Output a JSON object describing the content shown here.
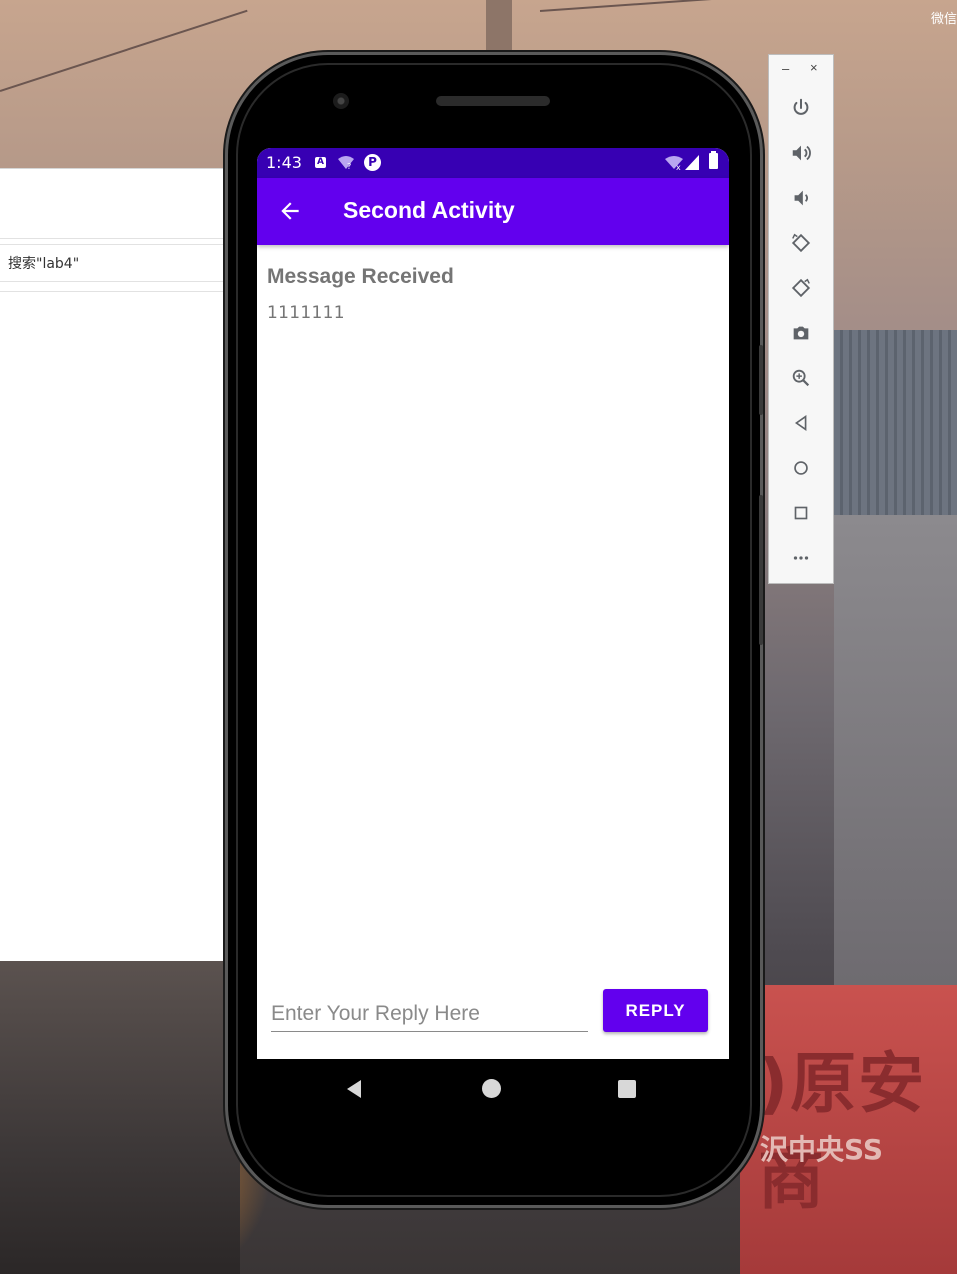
{
  "desktop": {
    "corner_text": "微信",
    "sign_big_text": ")原安商",
    "sign_small_text": "沢中央SS"
  },
  "ide": {
    "search_placeholder": "搜索\"lab4\""
  },
  "status_bar": {
    "time": "1:43",
    "notification_icons": [
      "a-icon",
      "wifi-question-icon",
      "circle-p-icon"
    ],
    "right_icons": [
      "wifi-off-icon",
      "signal-icon",
      "battery-icon"
    ]
  },
  "app_bar": {
    "title": "Second Activity",
    "back_icon": "arrow-back-icon"
  },
  "content": {
    "heading": "Message Received",
    "message": "1111111"
  },
  "reply": {
    "placeholder": "Enter Your Reply Here",
    "value": "",
    "button_label": "REPLY"
  },
  "colors": {
    "status_bar": "#3700b3",
    "primary": "#6200ee",
    "text_secondary": "#757575"
  },
  "nav_bar": {
    "buttons": [
      "back-icon",
      "home-icon",
      "recent-apps-icon"
    ]
  },
  "emulator_toolbar": {
    "minimize_label": "–",
    "close_label": "×",
    "buttons": [
      "power-icon",
      "volume-up-icon",
      "volume-down-icon",
      "rotate-left-icon",
      "rotate-right-icon",
      "camera-icon",
      "zoom-icon",
      "back-icon",
      "home-icon",
      "overview-icon",
      "more-icon"
    ]
  }
}
